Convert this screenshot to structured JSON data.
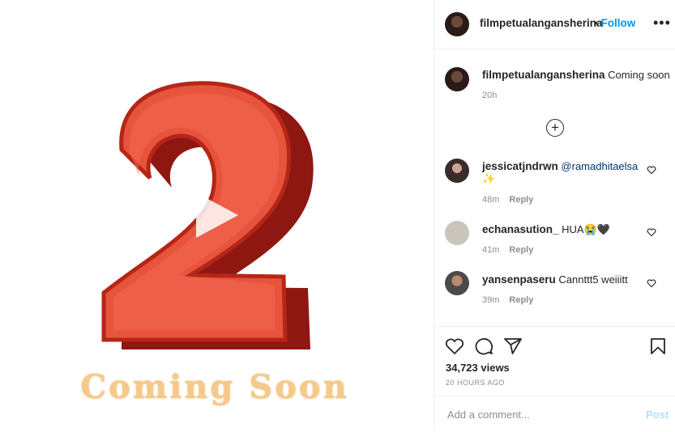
{
  "post": {
    "username": "filmpetualangansherina",
    "follow_label": "Follow",
    "separator": "•",
    "more_label": "•••",
    "caption": "Coming soon",
    "caption_time": "20h",
    "media_text_1": "Coming",
    "media_text_2": "Soon",
    "views": "34,723 views",
    "posted_ago": "20 HOURS AGO"
  },
  "comments": [
    {
      "username": "jessicatjndrwn",
      "text": "@ramadhitaelsa",
      "extra": "✨",
      "time": "48m",
      "reply_label": "Reply"
    },
    {
      "username": "echanasution_",
      "text": "HUA😭🖤",
      "time": "41m",
      "reply_label": "Reply"
    },
    {
      "username": "yansenpaseru",
      "text": "Cannttt5 weiiitt",
      "time": "39m",
      "reply_label": "Reply"
    }
  ],
  "composer": {
    "placeholder": "Add a comment...",
    "post_label": "Post"
  },
  "colors": {
    "accent": "#0095f6",
    "numeral": "#e8533c"
  },
  "icons": [
    "play-icon",
    "load-more-icon",
    "heart-icon",
    "comment-icon",
    "share-icon",
    "save-icon",
    "more-icon"
  ]
}
